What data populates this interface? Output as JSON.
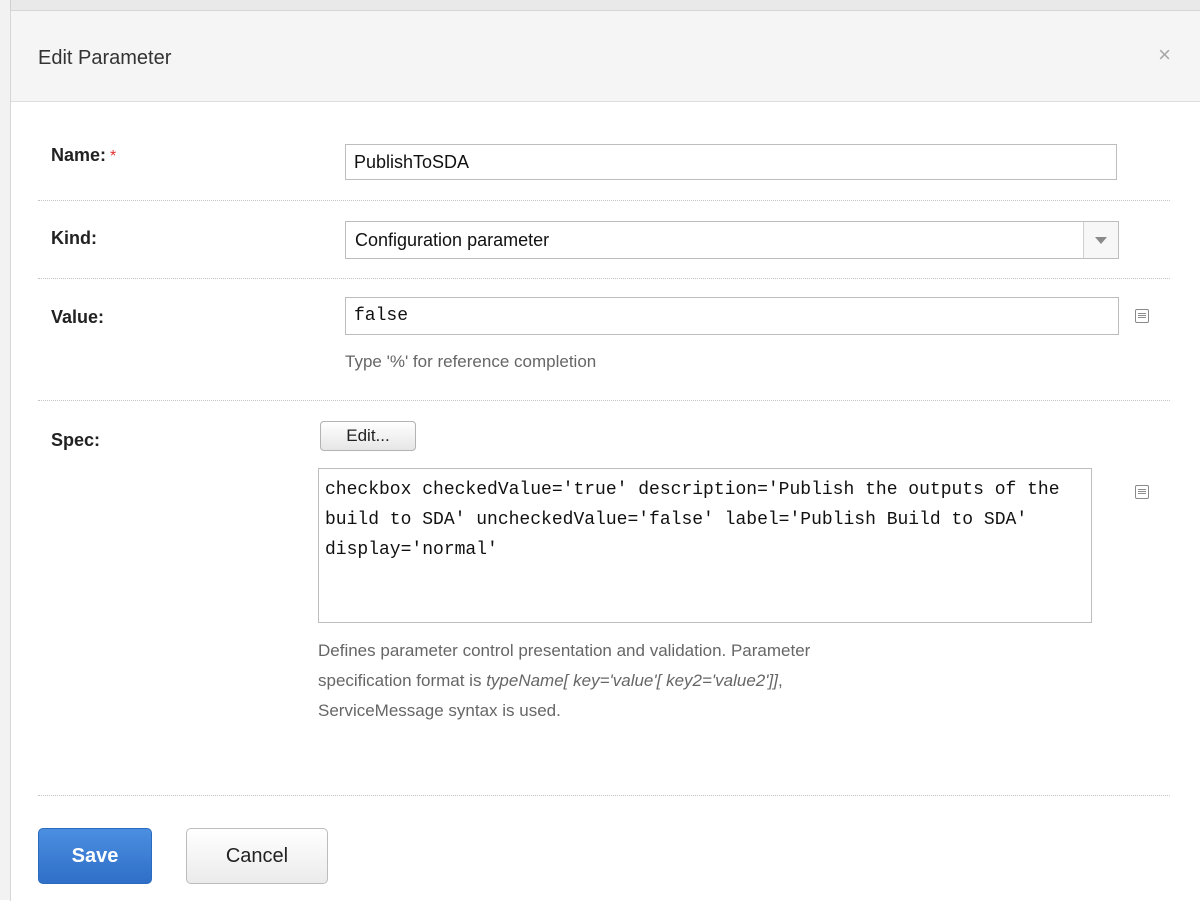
{
  "dialog": {
    "title": "Edit Parameter",
    "close_symbol": "×"
  },
  "form": {
    "name": {
      "label": "Name:",
      "required_mark": "*",
      "value": "PublishToSDA"
    },
    "kind": {
      "label": "Kind:",
      "selected": "Configuration parameter"
    },
    "value": {
      "label": "Value:",
      "value": "false",
      "hint": "Type '%' for reference completion"
    },
    "spec": {
      "label": "Spec:",
      "edit_button": "Edit...",
      "value": "checkbox checkedValue='true' description='Publish the outputs of the build to SDA' uncheckedValue='false' label='Publish Build to SDA' display='normal'",
      "hint_line1": "Defines parameter control presentation and validation. Parameter",
      "hint_line2_prefix": "specification format is ",
      "hint_line2_em": "typeName[ key='value'[ key2='value2']]",
      "hint_line2_suffix": ",",
      "hint_line3": "ServiceMessage syntax is used."
    }
  },
  "buttons": {
    "save": "Save",
    "cancel": "Cancel"
  },
  "icons": [
    "close-icon",
    "list-icon",
    "chevron-down-icon"
  ]
}
